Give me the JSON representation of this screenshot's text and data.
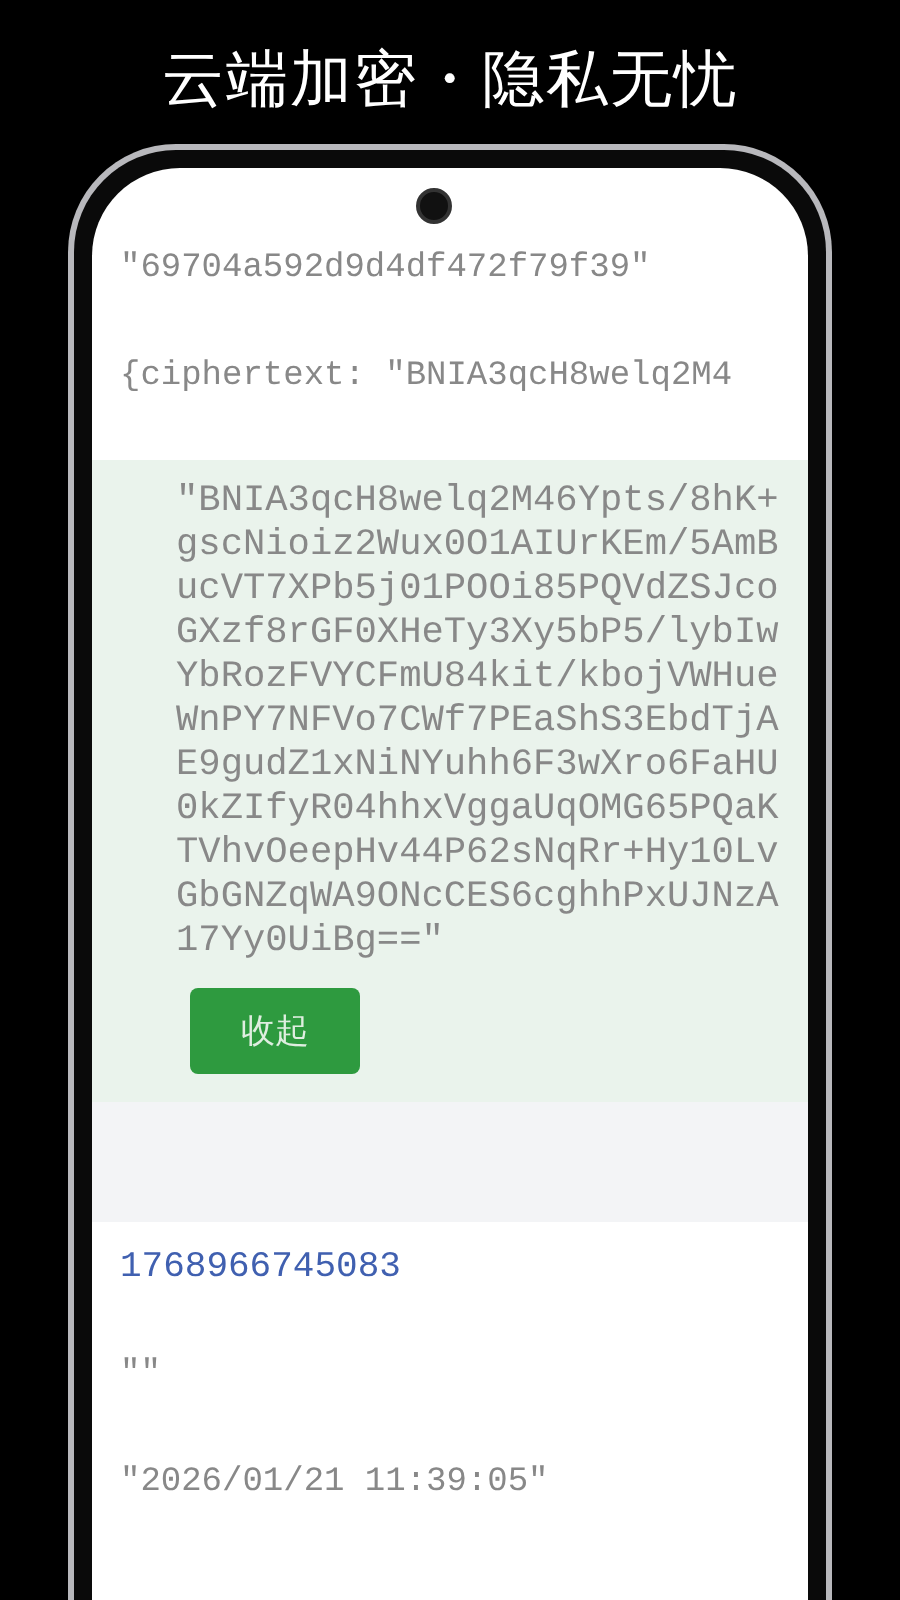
{
  "header": {
    "title": "云端加密・隐私无忧"
  },
  "screen": {
    "items": [
      {
        "kind": "string",
        "text": "\"69704a592d9d4df472f79f39\""
      },
      {
        "kind": "string",
        "text": "{ciphertext: \"BNIA3qcH8welq2M4"
      },
      {
        "kind": "block",
        "lines": [
          "\"BNIA3qcH8welq2M46Ypts/8hK+",
          "gscNioiz2Wux0O1AIUrKEm/5AmB",
          "ucVT7XPb5j01POOi85PQVdZSJco",
          "GXzf8rGF0XHeTy3Xy5bP5/lybIw",
          "YbRozFVYCFmU84kit/kbojVWHue",
          "WnPY7NFVo7CWf7PEaShS3EbdTjA",
          "E9gudZ1xNiNYuhh6F3wXro6FaHU",
          "0kZIfyR04hhxVggaUqOMG65PQaK",
          "TVhvOeepHv44P62sNqRr+Hy10Lv",
          "GbGNZqWA9ONcCES6cghhPxUJNzA",
          "17Yy0UiBg==\""
        ],
        "button": "收起"
      },
      {
        "kind": "number",
        "text": "1768966745083"
      },
      {
        "kind": "string",
        "text": "\"\""
      },
      {
        "kind": "string",
        "text": "\"2026/01/21 11:39:05\""
      }
    ]
  }
}
